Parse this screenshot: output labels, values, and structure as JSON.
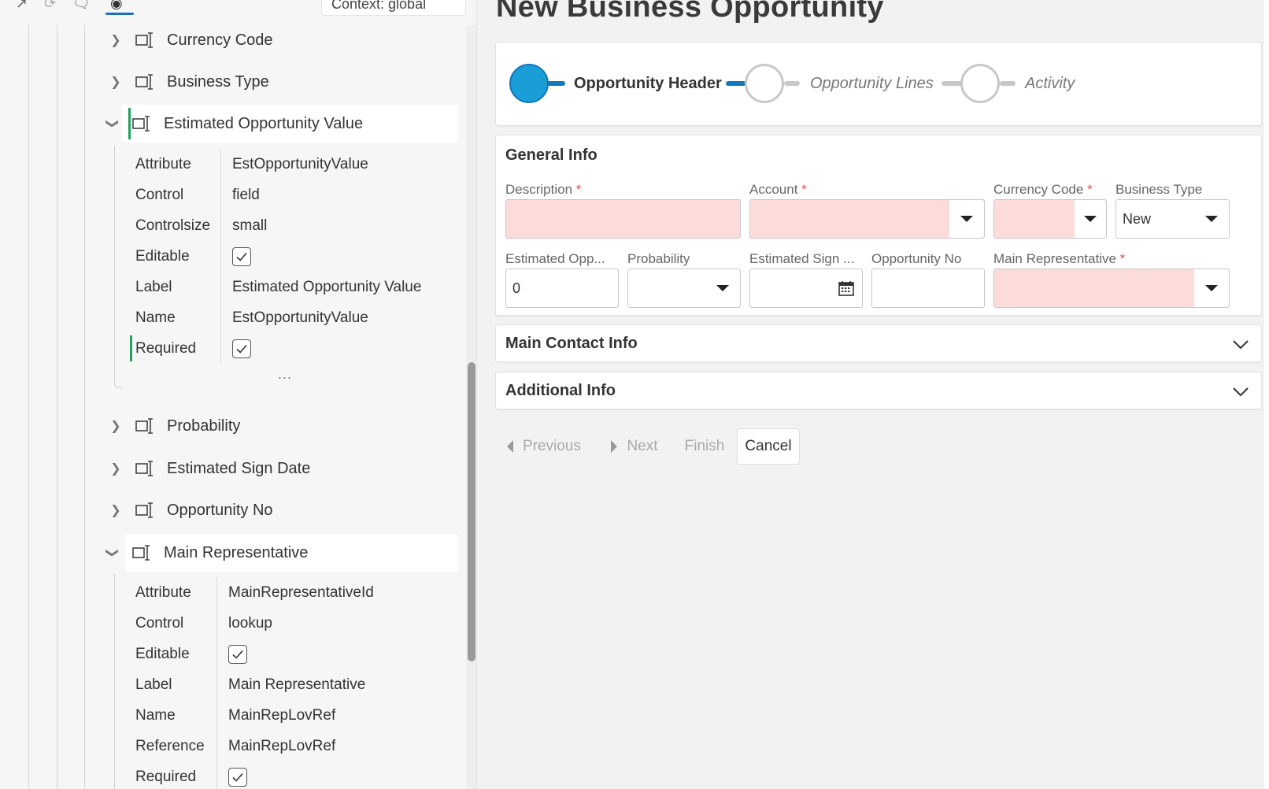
{
  "toolbar": {
    "context_label": "Context: global",
    "colors": {
      "tab_underline": "#1c6ec9"
    }
  },
  "tree": {
    "nodes": [
      {
        "label": "Currency Code",
        "expanded": false
      },
      {
        "label": "Business Type",
        "expanded": false
      },
      {
        "label": "Estimated Opportunity Value",
        "expanded": true
      },
      {
        "label": "Probability",
        "expanded": false
      },
      {
        "label": "Estimated Sign Date",
        "expanded": false
      },
      {
        "label": "Opportunity No",
        "expanded": false
      },
      {
        "label": "Main Representative",
        "expanded": true
      }
    ],
    "props_est_value": [
      {
        "key": "Attribute",
        "value": "EstOpportunityValue"
      },
      {
        "key": "Control",
        "value": "field"
      },
      {
        "key": "Controlsize",
        "value": "small"
      },
      {
        "key": "Editable",
        "checked": true
      },
      {
        "key": "Label",
        "value": "Estimated Opportunity Value"
      },
      {
        "key": "Name",
        "value": "EstOpportunityValue"
      },
      {
        "key": "Required",
        "checked": true
      }
    ],
    "more_label": "...",
    "props_main_rep": [
      {
        "key": "Attribute",
        "value": "MainRepresentativeId"
      },
      {
        "key": "Control",
        "value": "lookup"
      },
      {
        "key": "Editable",
        "checked": true
      },
      {
        "key": "Label",
        "value": "Main Representative"
      },
      {
        "key": "Name",
        "value": "MainRepLovRef"
      },
      {
        "key": "Reference",
        "value": "MainRepLovRef"
      },
      {
        "key": "Required",
        "checked": true
      }
    ]
  },
  "form": {
    "title": "New Business Opportunity",
    "steps": [
      {
        "label": "Opportunity Header",
        "state": "active"
      },
      {
        "label": "Opportunity Lines",
        "state": "pending"
      },
      {
        "label": "Activity",
        "state": "pending"
      }
    ],
    "general": {
      "title": "General Info",
      "required_mark": "*",
      "fields": {
        "description": {
          "label": "Description",
          "value": "",
          "required": true
        },
        "account": {
          "label": "Account",
          "value": "",
          "required": true
        },
        "currency_code": {
          "label": "Currency Code",
          "value": "",
          "required": true
        },
        "business_type": {
          "label": "Business Type",
          "value": "New",
          "required": false
        },
        "est_opp_value": {
          "label": "Estimated Opp...",
          "value": "0",
          "required": false
        },
        "probability": {
          "label": "Probability",
          "value": "",
          "required": false
        },
        "est_sign_date": {
          "label": "Estimated Sign ...",
          "value": "",
          "required": false
        },
        "opportunity_no": {
          "label": "Opportunity No",
          "value": "",
          "required": false
        },
        "main_rep": {
          "label": "Main Representative",
          "value": "",
          "required": true
        }
      }
    },
    "sections": {
      "main_contact": "Main Contact Info",
      "additional": "Additional Info"
    },
    "buttons": {
      "previous": "Previous",
      "next": "Next",
      "finish": "Finish",
      "cancel": "Cancel"
    },
    "colors": {
      "step_active": "#1a9ed8",
      "step_line_active": "#1576b8",
      "step_line_pending": "#c8c8c8",
      "invalid_fill": "#fcdcdb",
      "required": "#d9534f"
    }
  }
}
